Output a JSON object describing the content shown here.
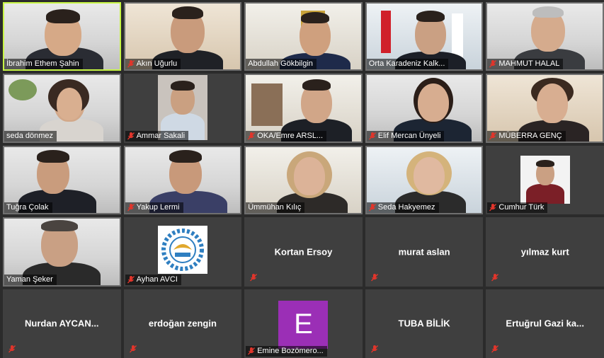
{
  "participants": [
    {
      "name": "İbrahim Ethem Şahin",
      "muted": false,
      "active": true
    },
    {
      "name": "Akın Uğurlu",
      "muted": true
    },
    {
      "name": "Abdullah Gökbilgin",
      "muted": false
    },
    {
      "name": "Orta Karadeniz Kalk...",
      "muted": false
    },
    {
      "name": "MAHMUT HALAL",
      "muted": true
    },
    {
      "name": "seda dönmez",
      "muted": false
    },
    {
      "name": "Ammar Sakali",
      "muted": true
    },
    {
      "name": "OKA/Emre ARSL...",
      "muted": true
    },
    {
      "name": "Elif Mercan Ünyeli",
      "muted": true
    },
    {
      "name": "MÜBERRA GENÇ",
      "muted": true
    },
    {
      "name": "Tuğra Çolak",
      "muted": false
    },
    {
      "name": "Yakup Lermi",
      "muted": true
    },
    {
      "name": "Ümmühan Kılıç",
      "muted": false
    },
    {
      "name": "Seda Hakyemez",
      "muted": true
    },
    {
      "name": "Cumhur Türk",
      "muted": true
    },
    {
      "name": "Yaman Şeker",
      "muted": false
    },
    {
      "name": "Ayhan AVCI",
      "muted": true
    },
    {
      "name": "Kortan Ersoy",
      "muted": true
    },
    {
      "name": "murat aslan",
      "muted": true
    },
    {
      "name": "yılmaz kurt",
      "muted": true
    },
    {
      "name": "Nurdan AYCAN...",
      "muted": true
    },
    {
      "name": "erdoğan zengin",
      "muted": true
    },
    {
      "name": "Emine Bozömero...",
      "muted": true,
      "avatar_letter": "E"
    },
    {
      "name": "TUBA BİLİK",
      "muted": true
    },
    {
      "name": "Ertuğrul Gazi ka...",
      "muted": true
    }
  ],
  "colors": {
    "active_border": "#c7f545",
    "mute_red": "#e0352b",
    "tile_off": "#3f3f3f",
    "avatar_purple": "#9b2fb6"
  }
}
